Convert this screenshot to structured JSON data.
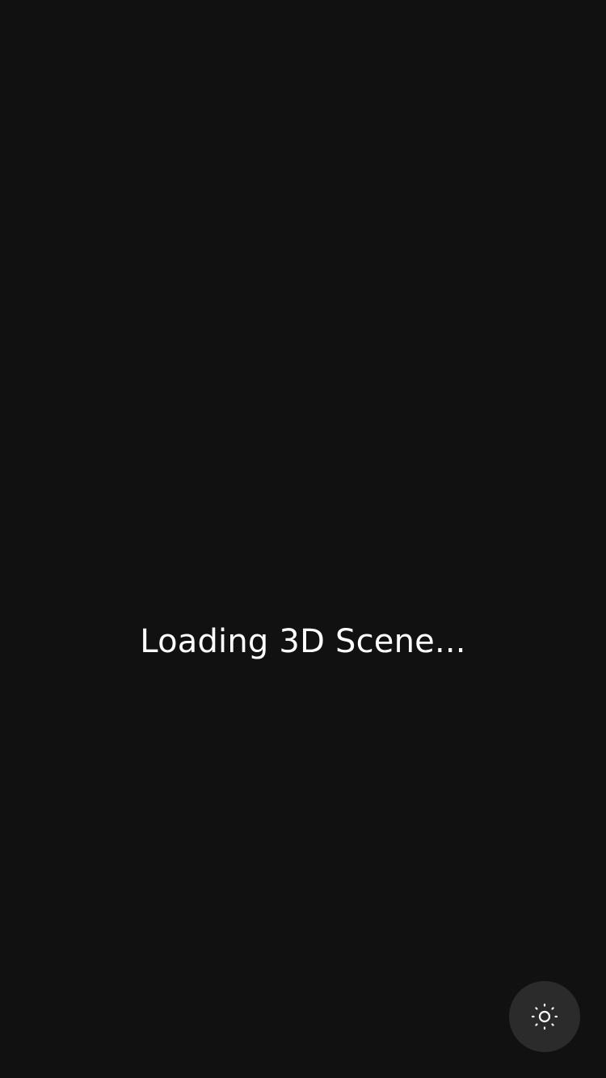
{
  "scene": {
    "loading_text": "Loading 3D Scene..."
  },
  "theme_toggle": {
    "icon": "sun-icon",
    "aria_label": "Toggle theme"
  },
  "colors": {
    "background": "#111111",
    "text": "#ffffff",
    "button_background": "#2b2b2b",
    "icon": "#ffffff"
  }
}
